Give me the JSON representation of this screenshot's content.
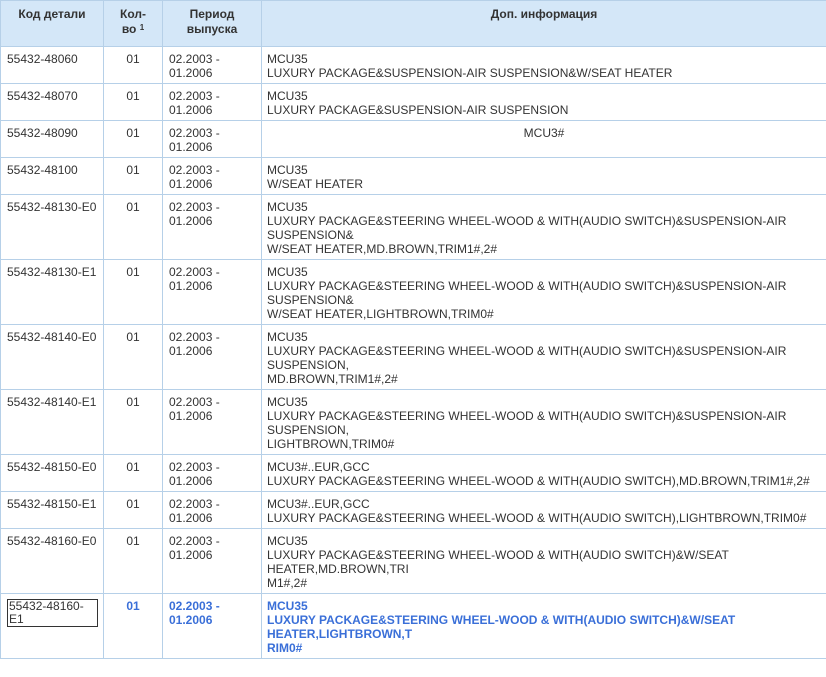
{
  "headers": {
    "code": "Код детали",
    "qty_line1": "Кол-",
    "qty_line2": "во",
    "qty_sup": "1",
    "period_line1": "Период",
    "period_line2": "выпуска",
    "info": "Доп. информация"
  },
  "rows": [
    {
      "code": "55432-48060",
      "qty": "01",
      "period": [
        "02.2003 -",
        "01.2006"
      ],
      "info": [
        "MCU35",
        "LUXURY PACKAGE&SUSPENSION-AIR SUSPENSION&W/SEAT HEATER"
      ]
    },
    {
      "code": "55432-48070",
      "qty": "01",
      "period": [
        "02.2003 -",
        "01.2006"
      ],
      "info": [
        "MCU35",
        "LUXURY PACKAGE&SUSPENSION-AIR SUSPENSION"
      ]
    },
    {
      "code": "55432-48090",
      "qty": "01",
      "period": [
        "02.2003 -",
        "01.2006"
      ],
      "info": [
        "MCU3#"
      ],
      "center": true
    },
    {
      "code": "55432-48100",
      "qty": "01",
      "period": [
        "02.2003 -",
        "01.2006"
      ],
      "info": [
        "MCU35",
        "W/SEAT HEATER"
      ]
    },
    {
      "code": "55432-48130-E0",
      "qty": "01",
      "period": [
        "02.2003 -",
        "01.2006"
      ],
      "info": [
        "MCU35",
        "LUXURY PACKAGE&STEERING WHEEL-WOOD & WITH(AUDIO SWITCH)&SUSPENSION-AIR",
        "SUSPENSION&",
        "W/SEAT HEATER,MD.BROWN,TRIM1#,2#"
      ]
    },
    {
      "code": "55432-48130-E1",
      "qty": "01",
      "period": [
        "02.2003 -",
        "01.2006"
      ],
      "info": [
        "MCU35",
        "LUXURY PACKAGE&STEERING WHEEL-WOOD & WITH(AUDIO SWITCH)&SUSPENSION-AIR",
        "SUSPENSION&",
        "W/SEAT HEATER,LIGHTBROWN,TRIM0#"
      ]
    },
    {
      "code": "55432-48140-E0",
      "qty": "01",
      "period": [
        "02.2003 -",
        "01.2006"
      ],
      "info": [
        "MCU35",
        "LUXURY PACKAGE&STEERING WHEEL-WOOD & WITH(AUDIO SWITCH)&SUSPENSION-AIR",
        "SUSPENSION,",
        "MD.BROWN,TRIM1#,2#"
      ]
    },
    {
      "code": "55432-48140-E1",
      "qty": "01",
      "period": [
        "02.2003 -",
        "01.2006"
      ],
      "info": [
        "MCU35",
        "LUXURY PACKAGE&STEERING WHEEL-WOOD & WITH(AUDIO SWITCH)&SUSPENSION-AIR",
        "SUSPENSION,",
        "LIGHTBROWN,TRIM0#"
      ]
    },
    {
      "code": "55432-48150-E0",
      "qty": "01",
      "period": [
        "02.2003 -",
        "01.2006"
      ],
      "info": [
        "MCU3#..EUR,GCC",
        "LUXURY PACKAGE&STEERING WHEEL-WOOD & WITH(AUDIO SWITCH),MD.BROWN,TRIM1#,2#"
      ]
    },
    {
      "code": "55432-48150-E1",
      "qty": "01",
      "period": [
        "02.2003 -",
        "01.2006"
      ],
      "info": [
        "MCU3#..EUR,GCC",
        "LUXURY PACKAGE&STEERING WHEEL-WOOD & WITH(AUDIO SWITCH),LIGHTBROWN,TRIM0#"
      ]
    },
    {
      "code": "55432-48160-E0",
      "qty": "01",
      "period": [
        "02.2003 -",
        "01.2006"
      ],
      "info": [
        "MCU35",
        "LUXURY PACKAGE&STEERING WHEEL-WOOD & WITH(AUDIO SWITCH)&W/SEAT",
        "HEATER,MD.BROWN,TRI",
        "M1#,2#"
      ]
    },
    {
      "code": "55432-48160-E1",
      "qty": "01",
      "period": [
        "02.2003 -",
        "01.2006"
      ],
      "info": [
        "MCU35",
        "LUXURY PACKAGE&STEERING WHEEL-WOOD & WITH(AUDIO SWITCH)&W/SEAT",
        "HEATER,LIGHTBROWN,T",
        "RIM0#"
      ],
      "active": true
    }
  ],
  "colors": {
    "header_bg": "#d4e7f8",
    "border": "#b6d0e8",
    "active_text": "#3a6fd8"
  }
}
